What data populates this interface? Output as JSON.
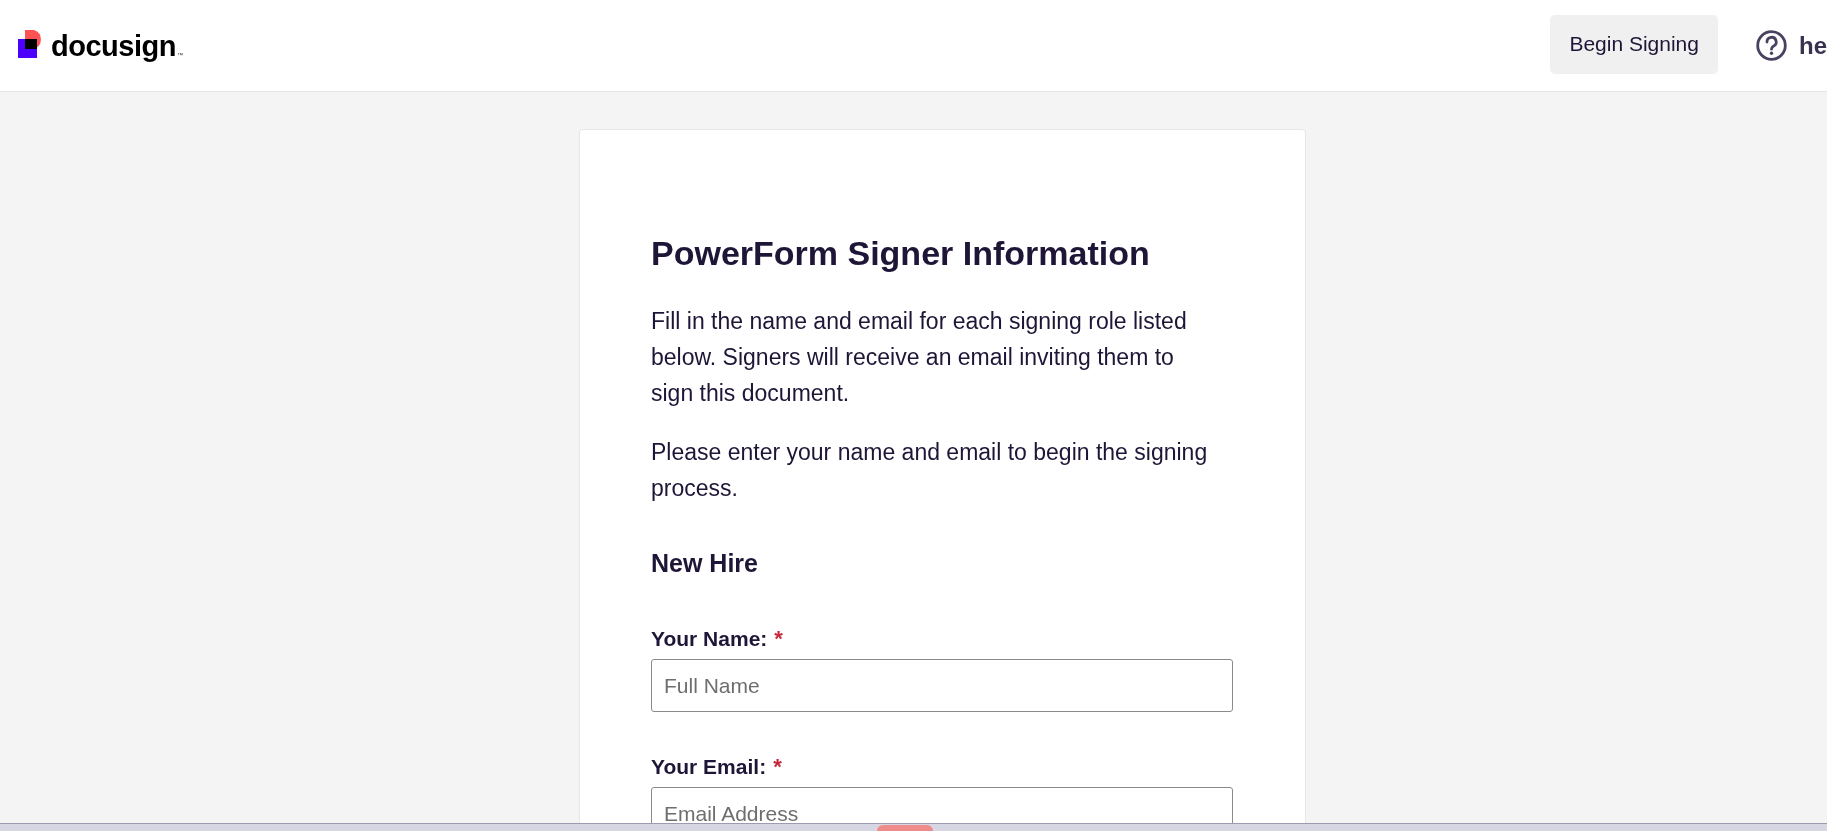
{
  "header": {
    "logo": {
      "wordmark": "docusign",
      "mark": "™"
    },
    "begin_button": "Begin Signing",
    "help_link": "he"
  },
  "form": {
    "title": "PowerForm Signer Information",
    "paragraphs": [
      "Fill in the name and email for each signing role listed below. Signers will receive an email inviting them to sign this document.",
      "Please enter your name and email to begin the signing process."
    ],
    "role": "New Hire",
    "fields": [
      {
        "label": "Your Name:",
        "required_mark": "*",
        "placeholder": "Full Name"
      },
      {
        "label": "Your Email:",
        "required_mark": "*",
        "placeholder": "Email Address"
      }
    ]
  }
}
